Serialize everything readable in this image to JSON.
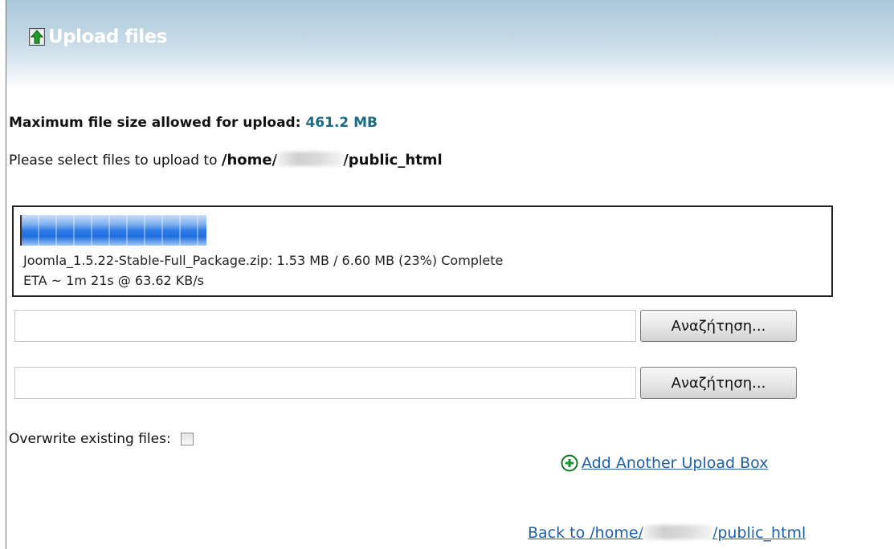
{
  "header": {
    "title": "Upload files",
    "icon": "upload-arrow-icon"
  },
  "info": {
    "max_size_label": "Maximum file size allowed for upload:",
    "max_size_value": "461.2 MB",
    "select_prefix": "Please select files to upload to",
    "path_start": "/home/",
    "path_end": "/public_html"
  },
  "progress": {
    "percent": 23,
    "line1": "Joomla_1.5.22-Stable-Full_Package.zip: 1.53 MB / 6.60 MB (23%) Complete",
    "line2": "ETA ~ 1m 21s @ 63.62 KB/s"
  },
  "uploads": [
    {
      "value": "",
      "button_label": "Αναζήτηση..."
    },
    {
      "value": "",
      "button_label": "Αναζήτηση..."
    }
  ],
  "overwrite": {
    "label": "Overwrite existing files:",
    "checked": false
  },
  "add_box": {
    "label": " Add Another Upload Box",
    "icon": "plus-circle-icon"
  },
  "back": {
    "prefix": "Back to /home/",
    "suffix": "/public_html"
  },
  "colors": {
    "link": "#1f5fa5",
    "size_value": "#1c6b86",
    "progress_blue": "#1f6fe2"
  }
}
